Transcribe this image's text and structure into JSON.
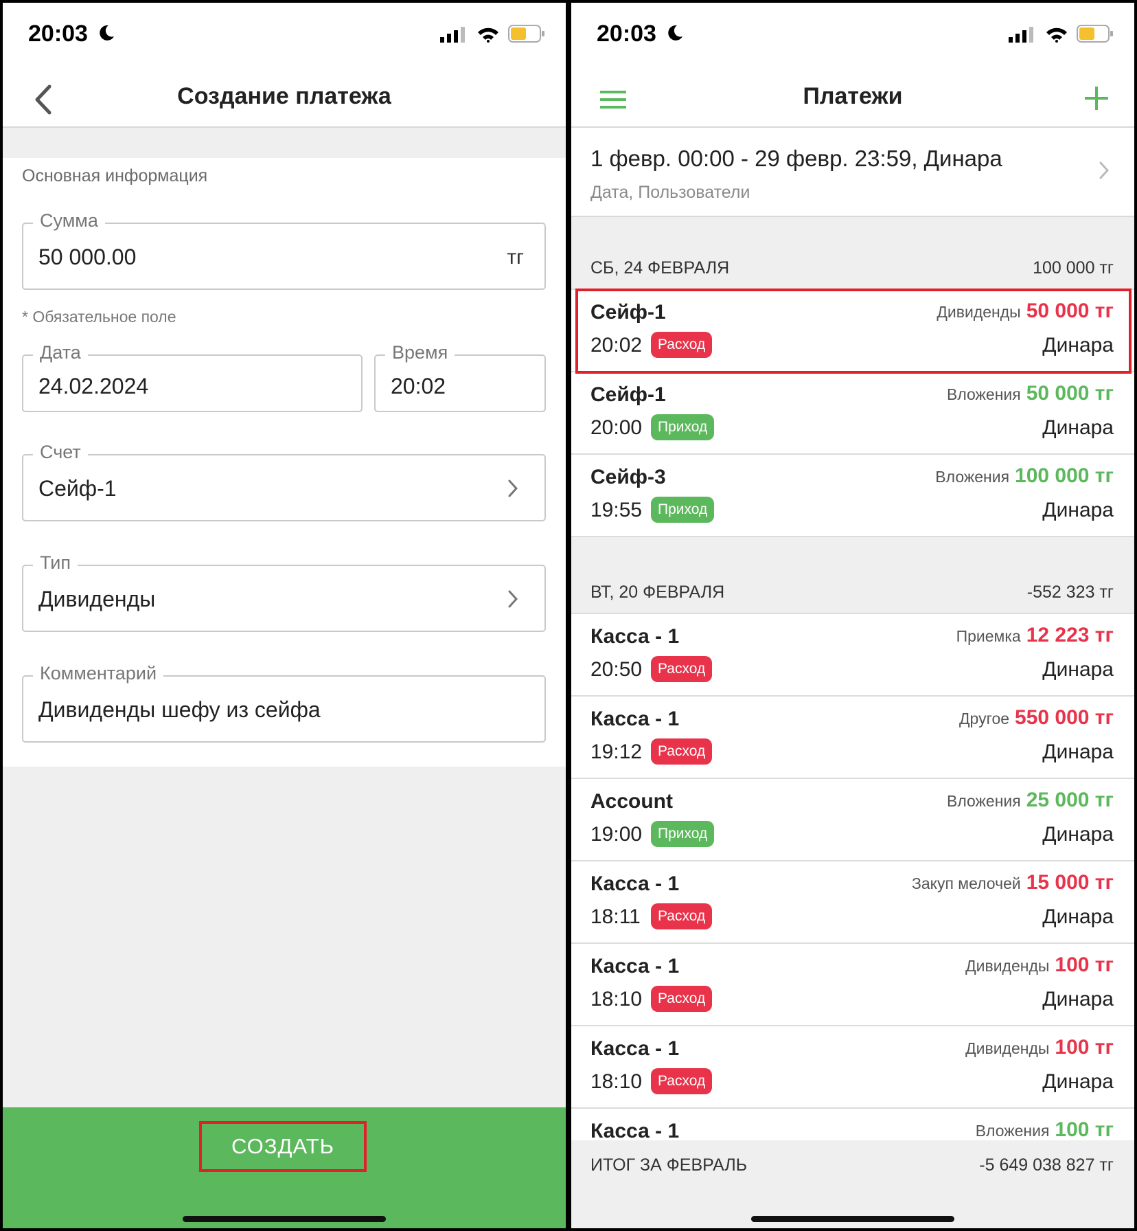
{
  "left": {
    "status_time": "20:03",
    "title": "Создание платежа",
    "section": "Основная информация",
    "amount": {
      "label": "Сумма",
      "value": "50 000.00",
      "suffix": "тг"
    },
    "required_hint": "* Обязательное поле",
    "date": {
      "label": "Дата",
      "value": "24.02.2024"
    },
    "time": {
      "label": "Время",
      "value": "20:02"
    },
    "account": {
      "label": "Счет",
      "value": "Сейф-1"
    },
    "type": {
      "label": "Тип",
      "value": "Дивиденды"
    },
    "comment": {
      "label": "Комментарий",
      "value": "Дивиденды шефу из сейфа"
    },
    "create_button": "СОЗДАТЬ"
  },
  "right": {
    "status_time": "20:03",
    "title": "Платежи",
    "filter_main": "1 февр. 00:00 - 29 февр. 23:59, Динара",
    "filter_sub": "Дата, Пользователи",
    "groups": [
      {
        "date": "СБ, 24 ФЕВРАЛЯ",
        "total": "100 000 тг"
      },
      {
        "date": "ВТ, 20 ФЕВРАЛЯ",
        "total": "-552 323 тг"
      }
    ],
    "rows": [
      {
        "account": "Сейф-1",
        "time": "20:02",
        "badge": "Расход",
        "category": "Дивиденды",
        "amount": "50 000 тг",
        "user": "Динара"
      },
      {
        "account": "Сейф-1",
        "time": "20:00",
        "badge": "Приход",
        "category": "Вложения",
        "amount": "50 000 тг",
        "user": "Динара"
      },
      {
        "account": "Сейф-3",
        "time": "19:55",
        "badge": "Приход",
        "category": "Вложения",
        "amount": "100 000 тг",
        "user": "Динара"
      },
      {
        "account": "Касса - 1",
        "time": "20:50",
        "badge": "Расход",
        "category": "Приемка",
        "amount": "12 223 тг",
        "user": "Динара"
      },
      {
        "account": "Касса - 1",
        "time": "19:12",
        "badge": "Расход",
        "category": "Другое",
        "amount": "550 000 тг",
        "user": "Динара"
      },
      {
        "account": "Account",
        "time": "19:00",
        "badge": "Приход",
        "category": "Вложения",
        "amount": "25 000 тг",
        "user": "Динара"
      },
      {
        "account": "Касса - 1",
        "time": "18:11",
        "badge": "Расход",
        "category": "Закуп мелочей",
        "amount": "15 000 тг",
        "user": "Динара"
      },
      {
        "account": "Касса - 1",
        "time": "18:10",
        "badge": "Расход",
        "category": "Дивиденды",
        "amount": "100 тг",
        "user": "Динара"
      },
      {
        "account": "Касса - 1",
        "time": "18:10",
        "badge": "Расход",
        "category": "Дивиденды",
        "amount": "100 тг",
        "user": "Динара"
      },
      {
        "account": "Касса - 1",
        "time": "",
        "badge": "",
        "category": "Вложения",
        "amount": "100 тг",
        "user": ""
      }
    ],
    "footer_label": "ИТОГ ЗА ФЕВРАЛЬ",
    "footer_total": "-5 649 038 827 тг"
  },
  "colors": {
    "green": "#5cb85c",
    "red": "#e8334a",
    "highlight": "#e0202a"
  }
}
